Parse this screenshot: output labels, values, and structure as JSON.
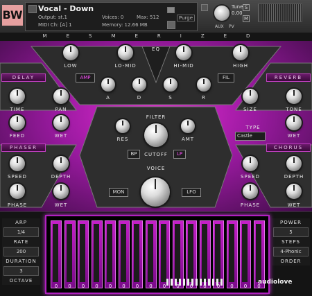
{
  "header": {
    "logo": "BW",
    "instrument_name": "Vocal - Down",
    "output": "Output: st.1",
    "midi": "MIDI Ch: [A] 1",
    "voices": "Voices: 0",
    "max": "Max: 512",
    "memory": "Memory: 12.66 MB",
    "purge": "Purge",
    "tune_label": "Tune",
    "tune_value": "0.00",
    "s": "S",
    "m": "M",
    "aux": "AUX",
    "pv": "PV"
  },
  "title_bar": "MESMERIZED",
  "eq": {
    "label": "EQ",
    "knobs": [
      "LOW",
      "LO-MID",
      "HI-MID",
      "HIGH"
    ]
  },
  "amp": {
    "label": "AMP",
    "knobs": [
      "A",
      "D",
      "S",
      "R"
    ]
  },
  "fil": {
    "label": "FIL"
  },
  "delay": {
    "label": "DELAY",
    "knobs": [
      "TIME",
      "PAN",
      "FEED",
      "WET"
    ]
  },
  "reverb": {
    "label": "REVERB",
    "knobs": [
      "SIZE",
      "TONE",
      "WET"
    ],
    "type_label": "TYPE",
    "type_value": "Castle"
  },
  "filter": {
    "label": "FILTER",
    "knobs": [
      "RES",
      "AMT"
    ],
    "mode_left": "BP",
    "mode_right": "LP",
    "cutoff": "CUTOFF"
  },
  "phaser": {
    "label": "PHASER",
    "knobs": [
      "SPEED",
      "DEPTH",
      "PHASE",
      "WET"
    ]
  },
  "chorus": {
    "label": "CHORUS",
    "knobs": [
      "SPEED",
      "DEPTH",
      "PHASE",
      "WET"
    ]
  },
  "voice": {
    "label": "VOICE",
    "mon": "MON",
    "lfo": "LFO"
  },
  "left_panel": {
    "arp": "ARP",
    "arp_val": "1/4",
    "rate": "RATE",
    "rate_val": "200",
    "duration": "DURATION",
    "duration_val": "3",
    "octave": "OCTAVE"
  },
  "right_panel": {
    "power": "POWER",
    "power_val": "5",
    "steps": "STEPS",
    "steps_val": "4-Phonic",
    "order": "ORDER"
  },
  "sequencer": {
    "step_values": [
      "0",
      "0",
      "0",
      "0",
      "0",
      "0",
      "0",
      "0",
      "0",
      "0",
      "0",
      "0",
      "0",
      "0",
      "0",
      "0"
    ]
  },
  "watermark": "audiolove"
}
